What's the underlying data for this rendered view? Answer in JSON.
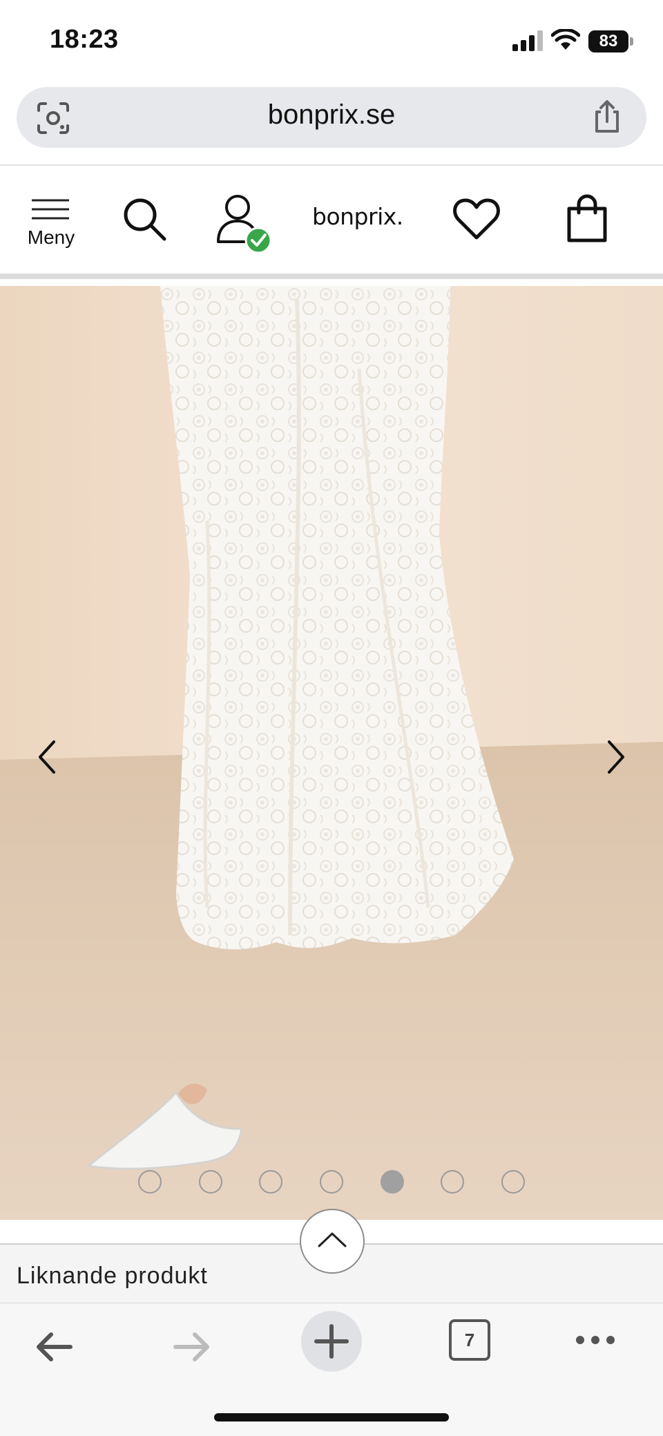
{
  "status_bar": {
    "time": "18:23",
    "battery": "83"
  },
  "browser": {
    "url": "bonprix.se",
    "tab_count": "7"
  },
  "site_header": {
    "menu_label": "Meny",
    "logo_text": "bonprix."
  },
  "product_gallery": {
    "image_count": 7,
    "active_index": 4,
    "dots": [
      {
        "active": false
      },
      {
        "active": false
      },
      {
        "active": false
      },
      {
        "active": false
      },
      {
        "active": true
      },
      {
        "active": false
      },
      {
        "active": false
      }
    ]
  },
  "section": {
    "similar_label": "Liknande produkt"
  },
  "colors": {
    "url_bar_bg": "#e6e8eb",
    "account_check": "#3aa64a",
    "image_bg": "#e8d3bd"
  },
  "icons": {
    "lens": "lens-icon",
    "share": "share-icon",
    "menu": "hamburger-icon",
    "search": "search-icon",
    "account": "account-icon",
    "wishlist": "heart-icon",
    "cart": "bag-icon",
    "prev": "chevron-left-icon",
    "next": "chevron-right-icon",
    "scroll_top": "chevron-up-icon",
    "back": "arrow-left-icon",
    "forward": "arrow-right-icon",
    "new_tab": "plus-icon",
    "more": "more-icon"
  }
}
